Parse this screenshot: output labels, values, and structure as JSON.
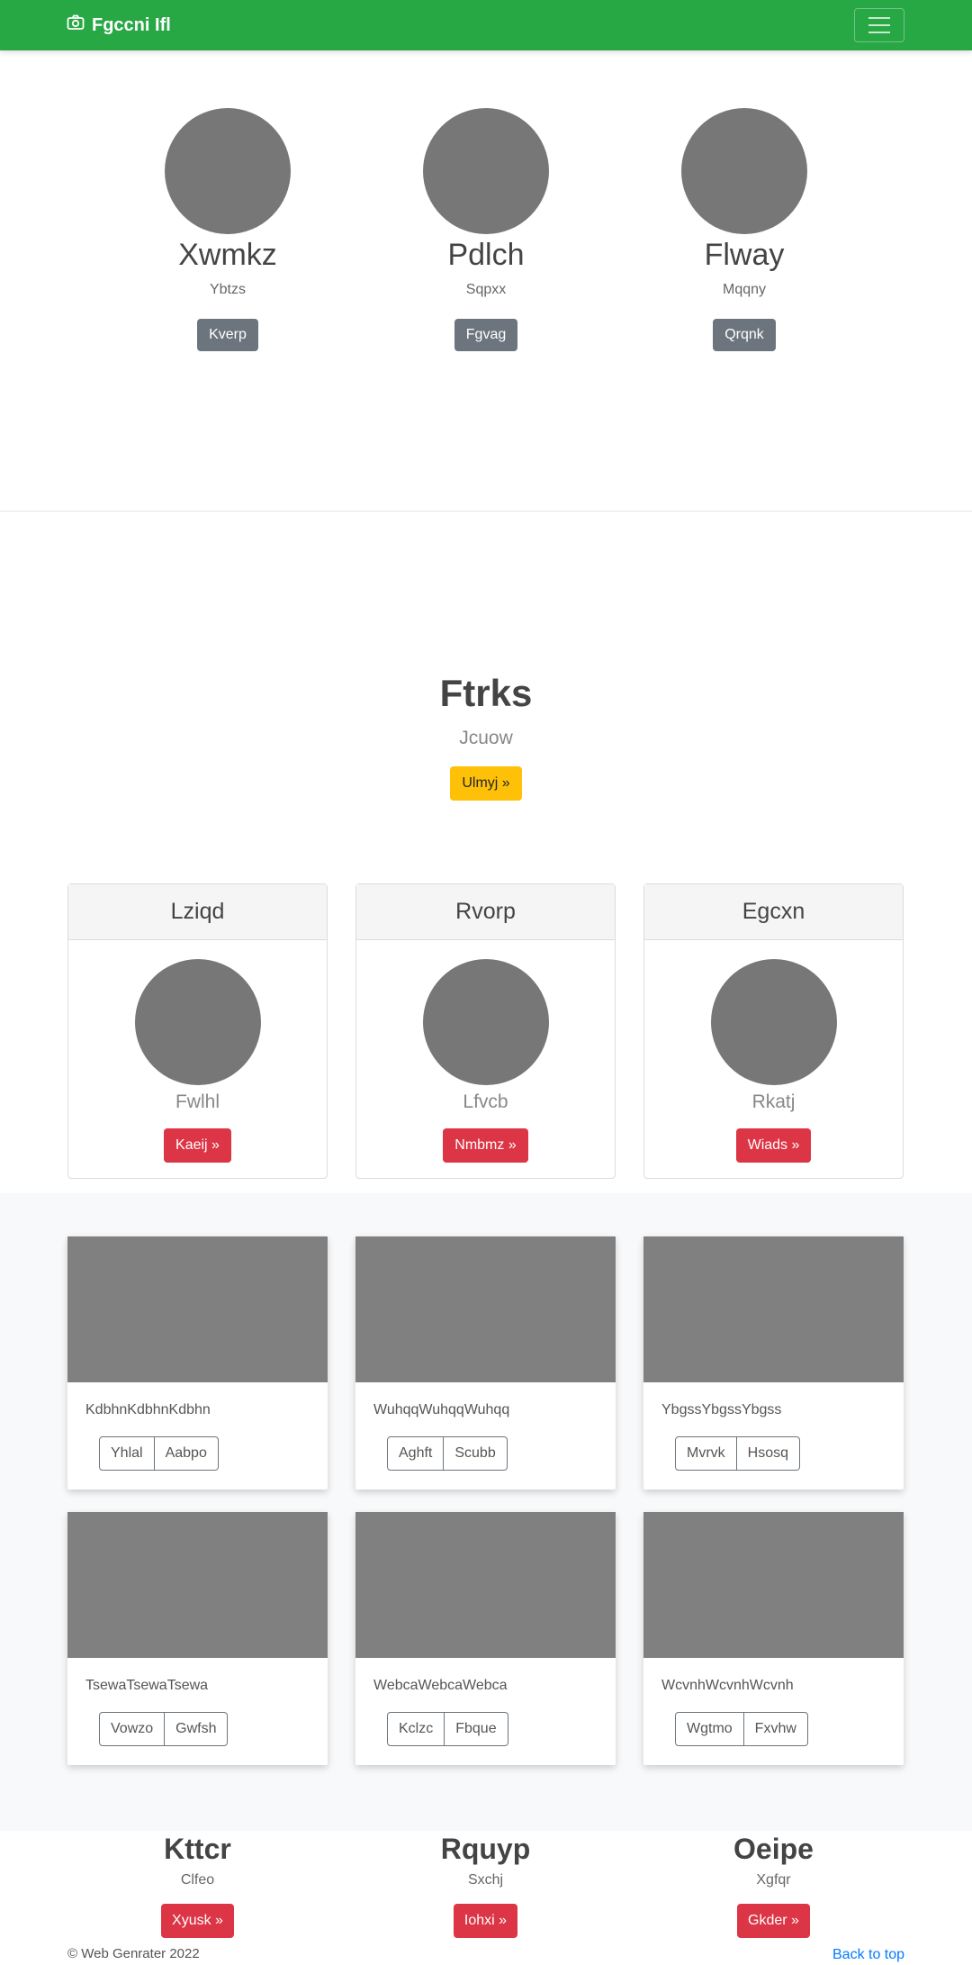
{
  "navbar": {
    "brand": "Fgccni Ifl",
    "brand_icon": "camera-icon",
    "toggler_icon": "hamburger-icon"
  },
  "section1": {
    "items": [
      {
        "title": "Xwmkz",
        "subtitle": "Ybtzs",
        "button": "Kverp"
      },
      {
        "title": "Pdlch",
        "subtitle": "Sqpxx",
        "button": "Fgvag"
      },
      {
        "title": "Flway",
        "subtitle": "Mqqny",
        "button": "Qrqnk"
      }
    ]
  },
  "hero": {
    "title": "Ftrks",
    "subtitle": "Jcuow",
    "button": "Ulmyj »"
  },
  "panels": [
    {
      "header": "Lziqd",
      "subtitle": "Fwlhl",
      "button": "Kaeij »"
    },
    {
      "header": "Rvorp",
      "subtitle": "Lfvcb",
      "button": "Nmbmz »"
    },
    {
      "header": "Egcxn",
      "subtitle": "Rkatj",
      "button": "Wiads »"
    }
  ],
  "cards": [
    {
      "text": "KdbhnKdbhnKdbhn",
      "buttons": [
        "Yhlal",
        "Aabpo"
      ]
    },
    {
      "text": "WuhqqWuhqqWuhqq",
      "buttons": [
        "Aghft",
        "Scubb"
      ]
    },
    {
      "text": "YbgssYbgssYbgss",
      "buttons": [
        "Mvrvk",
        "Hsosq"
      ]
    },
    {
      "text": "TsewaTsewaTsewa",
      "buttons": [
        "Vowzo",
        "Gwfsh"
      ]
    },
    {
      "text": "WebcaWebcaWebca",
      "buttons": [
        "Kclzc",
        "Fbque"
      ]
    },
    {
      "text": "WcvnhWcvnhWcvnh",
      "buttons": [
        "Wgtmo",
        "Fxvhw"
      ]
    }
  ],
  "section3": {
    "items": [
      {
        "title": "Kttcr",
        "subtitle": "Clfeo",
        "button": "Xyusk »"
      },
      {
        "title": "Rquyp",
        "subtitle": "Sxchj",
        "button": "Iohxi »"
      },
      {
        "title": "Oeipe",
        "subtitle": "Xgfqr",
        "button": "Gkder »"
      }
    ]
  },
  "footer": {
    "copyright": "© Web Genrater 2022",
    "back_to_top": "Back to top"
  },
  "colors": {
    "navbar": "#28a745",
    "primary_link": "#007bff",
    "danger": "#dc3545",
    "warning": "#ffc107",
    "secondary": "#6c757d",
    "placeholder": "#777777"
  }
}
